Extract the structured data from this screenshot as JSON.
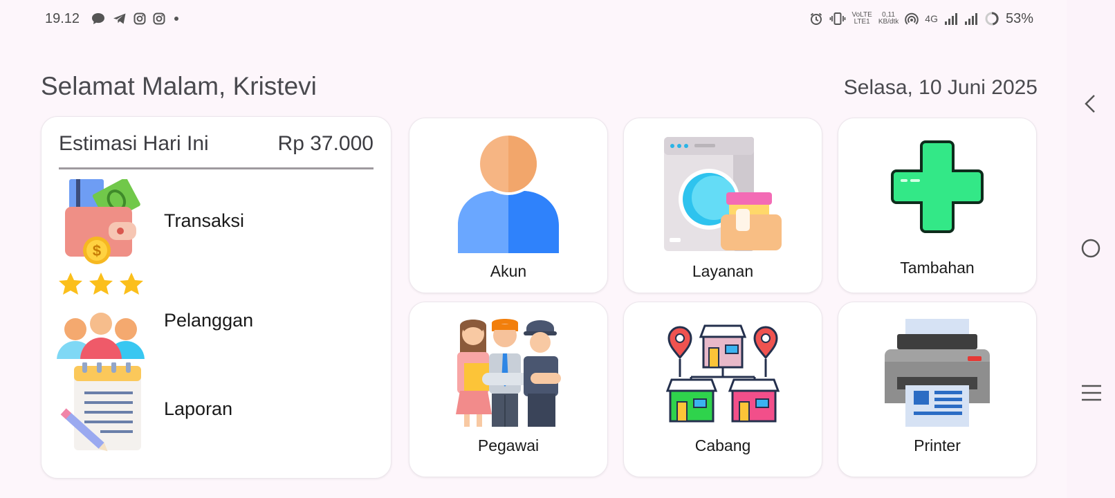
{
  "status_bar": {
    "time": "19.12",
    "notification_icons": [
      "chat-bubble-icon",
      "telegram-icon",
      "instagram-icon",
      "instagram-icon",
      "dot-icon"
    ],
    "network_lte": [
      "VoLTE",
      "LTE1"
    ],
    "speed": [
      "0,11",
      "KB/dtk"
    ],
    "network_type": "4G",
    "battery": "53%"
  },
  "header": {
    "greeting": "Selamat Malam, Kristevi",
    "date": "Selasa, 10 Juni 2025"
  },
  "summary": {
    "title": "Estimasi Hari Ini",
    "amount": "Rp 37.000",
    "items": [
      {
        "label": "Transaksi",
        "icon": "wallet-icon"
      },
      {
        "label": "Pelanggan",
        "icon": "customers-icon"
      },
      {
        "label": "Laporan",
        "icon": "notepad-icon"
      }
    ]
  },
  "menu": [
    {
      "label": "Akun",
      "icon": "user-icon"
    },
    {
      "label": "Layanan",
      "icon": "washing-machine-icon"
    },
    {
      "label": "Tambahan",
      "icon": "plus-icon"
    },
    {
      "label": "Pegawai",
      "icon": "employees-icon"
    },
    {
      "label": "Cabang",
      "icon": "branch-network-icon"
    },
    {
      "label": "Printer",
      "icon": "printer-icon"
    }
  ],
  "colors": {
    "background": "#fdf6fb",
    "card": "#ffffff",
    "text": "#4a4a4f",
    "plus_green": "#33e887",
    "user_blue": "#2f87ff",
    "user_skin": "#f6ac72"
  },
  "nav": {
    "icons": [
      "back-icon",
      "home-icon",
      "recents-icon"
    ]
  }
}
